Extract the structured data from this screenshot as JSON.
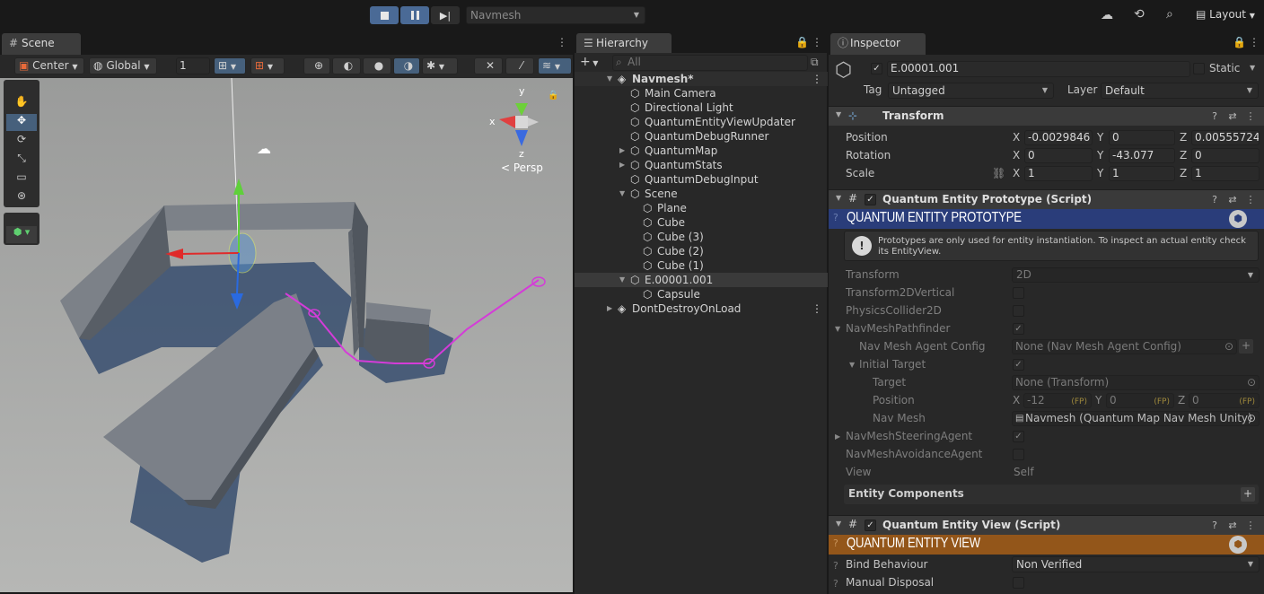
{
  "topbar": {
    "scene_select": "Navmesh",
    "layout_label": "Layout"
  },
  "scene": {
    "tab_label": "Scene",
    "pivot_label": "Center",
    "space_label": "Global",
    "grid_size": "1",
    "persp_label": "< Persp",
    "axis_x": "x",
    "axis_y": "y",
    "axis_z": "z"
  },
  "hierarchy": {
    "tab_label": "Hierarchy",
    "search_placeholder": "All",
    "rows": [
      {
        "label": "Navmesh*"
      },
      {
        "label": "Main Camera"
      },
      {
        "label": "Directional Light"
      },
      {
        "label": "QuantumEntityViewUpdater"
      },
      {
        "label": "QuantumDebugRunner"
      },
      {
        "label": "QuantumMap"
      },
      {
        "label": "QuantumStats"
      },
      {
        "label": "QuantumDebugInput"
      },
      {
        "label": "Scene"
      },
      {
        "label": "Plane"
      },
      {
        "label": "Cube"
      },
      {
        "label": "Cube (3)"
      },
      {
        "label": "Cube (2)"
      },
      {
        "label": "Cube (1)"
      },
      {
        "label": "E.00001.001"
      },
      {
        "label": "Capsule"
      },
      {
        "label": "DontDestroyOnLoad"
      }
    ]
  },
  "inspector": {
    "tab_label": "Inspector",
    "object_name": "E.00001.001",
    "static_label": "Static",
    "tag_label": "Tag",
    "tag_value": "Untagged",
    "layer_label": "Layer",
    "layer_value": "Default",
    "transform": {
      "title": "Transform",
      "position_label": "Position",
      "rotation_label": "Rotation",
      "scale_label": "Scale",
      "position": {
        "x": "-0.0029846",
        "y": "0",
        "z": "0.00555724"
      },
      "rotation": {
        "x": "0",
        "y": "-43.077",
        "z": "0"
      },
      "scale": {
        "x": "1",
        "y": "1",
        "z": "1"
      }
    },
    "prototype": {
      "title": "Quantum Entity Prototype (Script)",
      "banner": "QUANTUM ENTITY PROTOTYPE",
      "help": "Prototypes are only used for entity instantiation. To inspect an actual entity check its EntityView.",
      "transform_label": "Transform",
      "transform_value": "2D",
      "t2dv_label": "Transform2DVertical",
      "collider_label": "PhysicsCollider2D",
      "pathfinder_label": "NavMeshPathfinder",
      "agent_config_label": "Nav Mesh Agent Config",
      "agent_config_value": "None (Nav Mesh Agent Config)",
      "initial_target_label": "Initial Target",
      "target_label": "Target",
      "target_value": "None (Transform)",
      "position_label": "Position",
      "pos_x": "-12",
      "pos_y": "0",
      "pos_z": "0",
      "fp": "(FP)",
      "navmesh_label": "Nav Mesh",
      "navmesh_value": "Navmesh (Quantum Map Nav Mesh Unity)",
      "steering_label": "NavMeshSteeringAgent",
      "avoidance_label": "NavMeshAvoidanceAgent",
      "view_label": "View",
      "view_value": "Self",
      "components_label": "Entity Components"
    },
    "entity_view": {
      "title": "Quantum Entity View (Script)",
      "banner": "QUANTUM ENTITY VIEW",
      "bind_label": "Bind Behaviour",
      "bind_value": "Non Verified",
      "disposal_label": "Manual Disposal"
    }
  },
  "colors": {
    "proto_banner": "#2a3d7a",
    "view_banner": "#93561a",
    "navpath": "#d43cd8",
    "selected_tool": "#46607c"
  }
}
